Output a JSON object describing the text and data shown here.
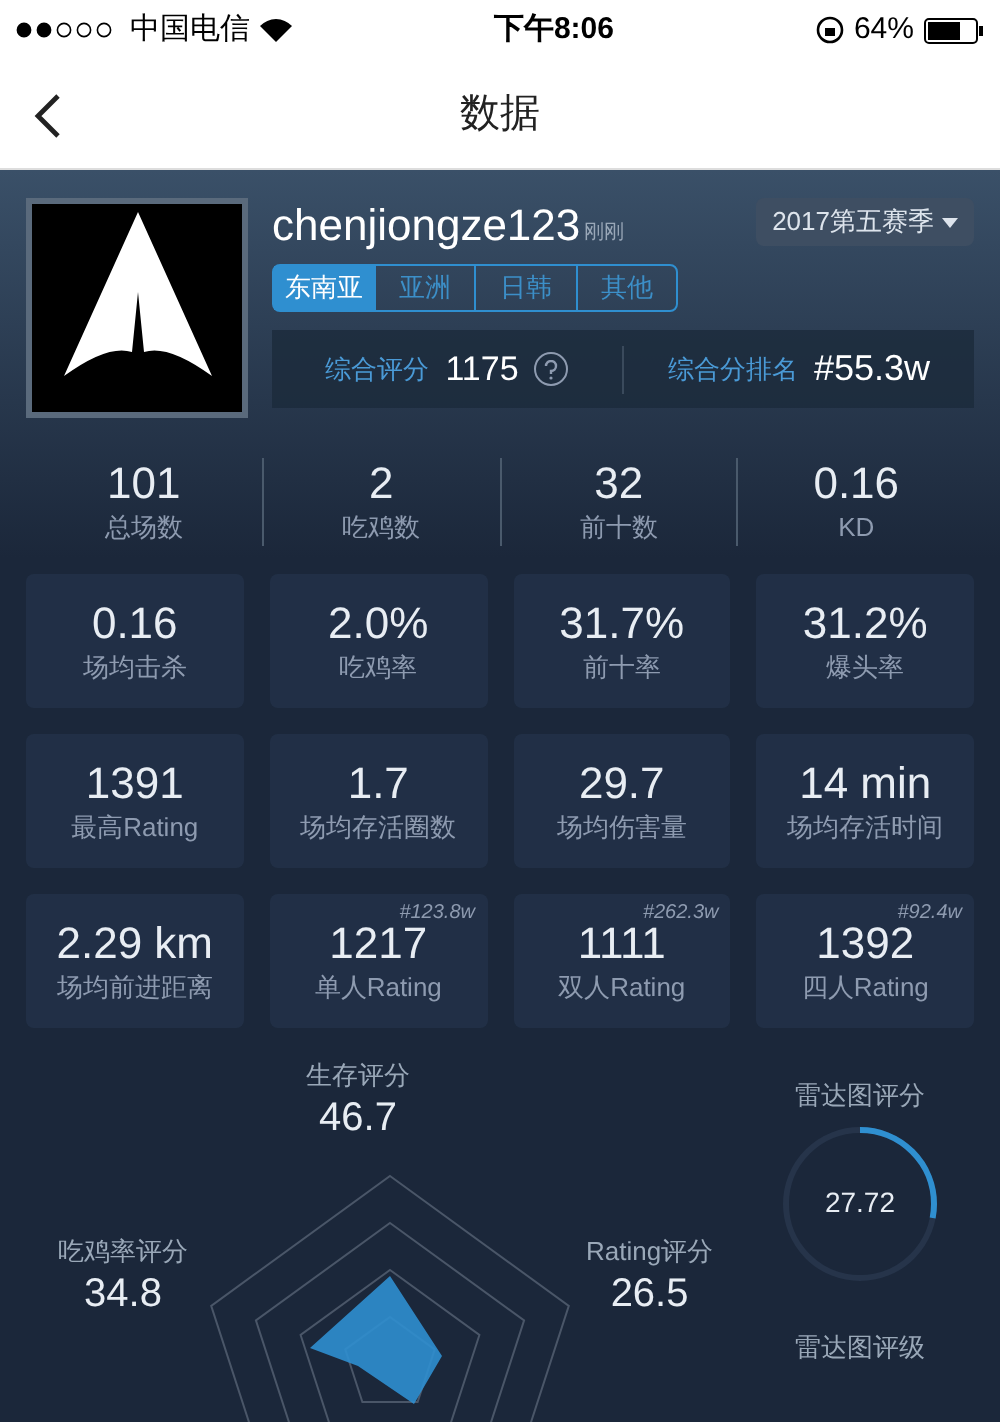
{
  "status_bar": {
    "carrier": "中国电信",
    "time": "下午8:06",
    "battery": "64%"
  },
  "nav": {
    "title": "数据"
  },
  "profile": {
    "name": "chenjiongze123",
    "updated": "刚刚",
    "season": "2017第五赛季"
  },
  "regions": [
    {
      "label": "东南亚",
      "selected": true
    },
    {
      "label": "亚洲",
      "selected": false
    },
    {
      "label": "日韩",
      "selected": false
    },
    {
      "label": "其他",
      "selected": false
    }
  ],
  "score": {
    "label": "综合评分",
    "value": "1175",
    "rank_label": "综合分排名",
    "rank": "#55.3w"
  },
  "summary": [
    {
      "value": "101",
      "label": "总场数"
    },
    {
      "value": "2",
      "label": "吃鸡数"
    },
    {
      "value": "32",
      "label": "前十数"
    },
    {
      "value": "0.16",
      "label": "KD"
    }
  ],
  "cards": [
    {
      "value": "0.16",
      "label": "场均击杀"
    },
    {
      "value": "2.0%",
      "label": "吃鸡率"
    },
    {
      "value": "31.7%",
      "label": "前十率"
    },
    {
      "value": "31.2%",
      "label": "爆头率"
    },
    {
      "value": "1391",
      "label": "最高Rating"
    },
    {
      "value": "1.7",
      "label": "场均存活圈数"
    },
    {
      "value": "29.7",
      "label": "场均伤害量"
    },
    {
      "value": "14 min",
      "label": "场均存活时间"
    },
    {
      "value": "2.29 km",
      "label": "场均前进距离"
    },
    {
      "value": "1217",
      "label": "单人Rating",
      "rank": "#123.8w"
    },
    {
      "value": "1111",
      "label": "双人Rating",
      "rank": "#262.3w"
    },
    {
      "value": "1392",
      "label": "四人Rating",
      "rank": "#92.4w"
    }
  ],
  "radar": {
    "labels": [
      {
        "label": "生存评分",
        "value": "46.7"
      },
      {
        "label": "吃鸡率评分",
        "value": "34.8"
      },
      {
        "label": "Rating评分",
        "value": "26.5"
      }
    ]
  },
  "gauge": {
    "title": "雷达图评分",
    "value": "27.72",
    "level": 0.28
  },
  "grade": {
    "title": "雷达图评级"
  }
}
